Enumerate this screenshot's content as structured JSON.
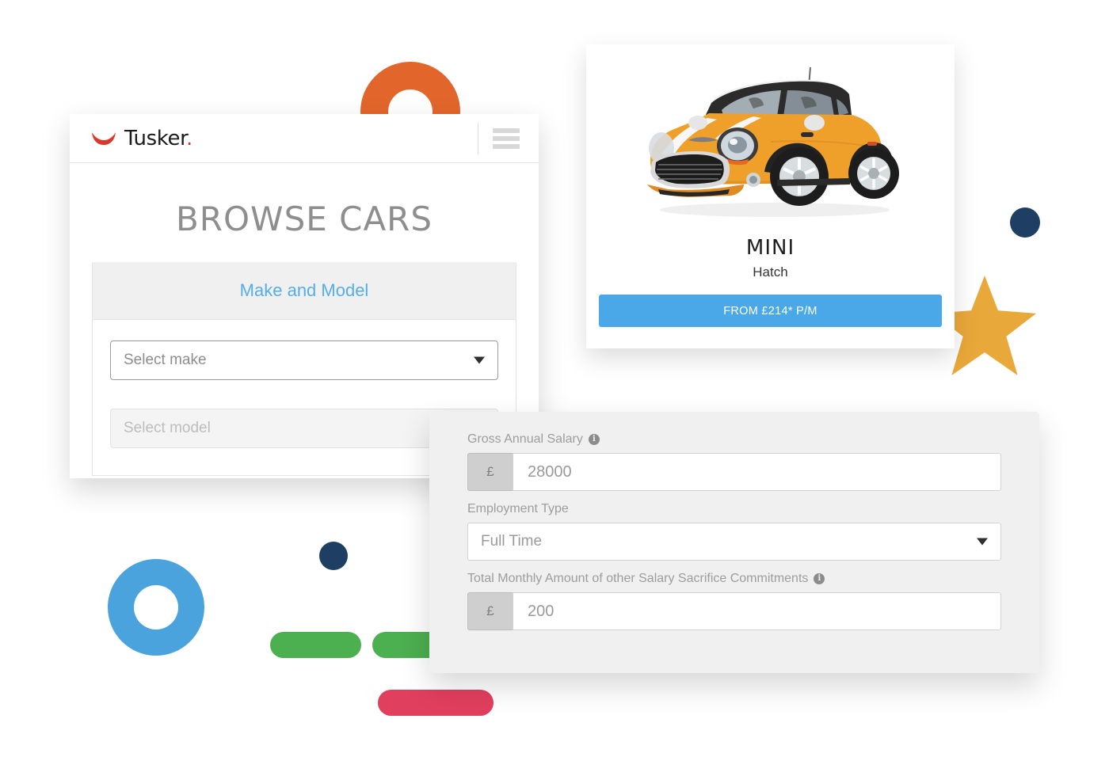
{
  "browse_card": {
    "logo": {
      "text": "Tusker",
      "dot": ".",
      "smile_color": "#D8392B"
    },
    "menu_icon": "hamburger-icon",
    "page_title": "BROWSE CARS",
    "section": {
      "header": "Make and Model",
      "header_color": "#55AEE8",
      "fields": [
        {
          "placeholder": "Select make",
          "state": "enabled"
        },
        {
          "placeholder": "Select model",
          "state": "disabled"
        }
      ]
    }
  },
  "car_card": {
    "image_alt": "orange-mini-hatch-car",
    "make": "MINI",
    "model": "Hatch",
    "price_button": "FROM £214* P/M",
    "price_button_color": "#4BA8E8"
  },
  "salary_panel": {
    "fields": [
      {
        "label": "Gross Annual Salary",
        "has_info": true,
        "prefix": "£",
        "value": "28000",
        "type": "text"
      },
      {
        "label": "Employment Type",
        "has_info": false,
        "value": "Full Time",
        "type": "select"
      },
      {
        "label": "Total Monthly Amount of other Salary Sacrifice Commitments",
        "has_info": true,
        "prefix": "£",
        "value": "200",
        "type": "text"
      }
    ],
    "info_glyph": "i"
  },
  "decorations": {
    "orange_donut": "#E2662C",
    "blue_donut": "#4BA3DE",
    "navy_dot": "#1E3E63",
    "green_pill": "#4CAF50",
    "pink_pill": "#E13F5E",
    "gold_star": "#E9A83A"
  }
}
